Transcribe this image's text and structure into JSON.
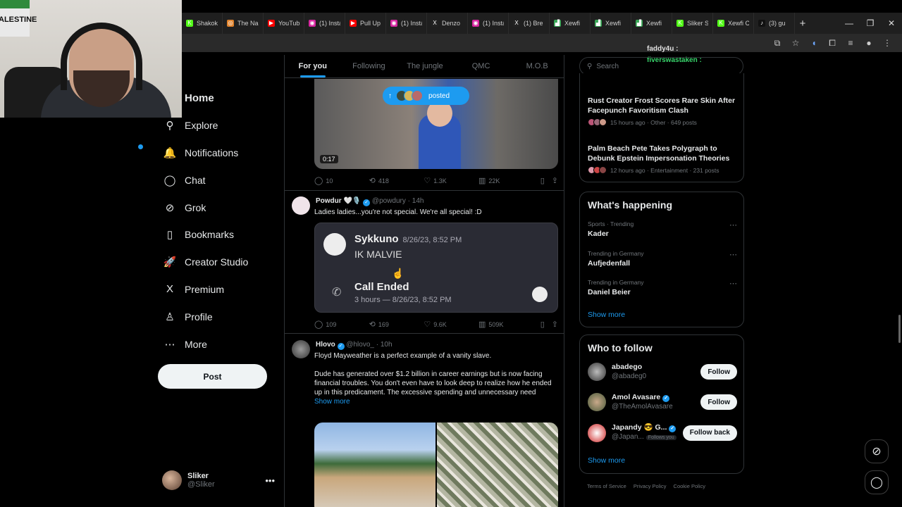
{
  "browser": {
    "tabs": [
      {
        "label": "Shakok",
        "icon": "K",
        "color": "#53fc18"
      },
      {
        "label": "The Na",
        "icon": "◎",
        "color": "#e0822b"
      },
      {
        "label": "YouTub",
        "icon": "▶",
        "color": "#ff0000"
      },
      {
        "label": "(1) Insta",
        "icon": "◉",
        "color": "#d6249f"
      },
      {
        "label": "Pull Up",
        "icon": "▶",
        "color": "#ff0000"
      },
      {
        "label": "(1) Insta",
        "icon": "◉",
        "color": "#d6249f"
      },
      {
        "label": "Denzo",
        "icon": "X",
        "color": "#222222"
      },
      {
        "label": "(1) Insta",
        "icon": "◉",
        "color": "#d6249f"
      },
      {
        "label": "(1) Bre",
        "icon": "X",
        "color": "#222222"
      },
      {
        "label": "Xewfi",
        "icon": "▟",
        "color": "#3aa757"
      },
      {
        "label": "Xewfi",
        "icon": "▟",
        "color": "#3aa757"
      },
      {
        "label": "Xewfi",
        "icon": "▟",
        "color": "#3aa757"
      },
      {
        "label": "Sliker S",
        "icon": "K",
        "color": "#53fc18"
      },
      {
        "label": "Xewfi C",
        "icon": "K",
        "color": "#53fc18"
      },
      {
        "label": "(3) gu",
        "icon": "♪",
        "color": "#111111"
      }
    ]
  },
  "stream_chat": {
    "line1": "faddy4u :",
    "line2": "fiverswastaken :"
  },
  "nav": {
    "items": [
      {
        "name": "home",
        "label": "Home",
        "icon": "⌂"
      },
      {
        "name": "explore",
        "label": "Explore",
        "icon": "⚲"
      },
      {
        "name": "notifications",
        "label": "Notifications",
        "icon": "🔔"
      },
      {
        "name": "chat",
        "label": "Chat",
        "icon": "◯"
      },
      {
        "name": "grok",
        "label": "Grok",
        "icon": "⊘"
      },
      {
        "name": "bookmarks",
        "label": "Bookmarks",
        "icon": "▯"
      },
      {
        "name": "creator-studio",
        "label": "Creator Studio",
        "icon": "🚀"
      },
      {
        "name": "premium",
        "label": "Premium",
        "icon": "X"
      },
      {
        "name": "profile",
        "label": "Profile",
        "icon": "♙"
      },
      {
        "name": "more",
        "label": "More",
        "icon": "⋯"
      }
    ],
    "post_label": "Post",
    "me_name": "Sliker",
    "me_handle": "@Sliker"
  },
  "feed": {
    "tabs": [
      "For you",
      "Following",
      "The jungle",
      "QMC",
      "M.O.B"
    ],
    "posted_label": "posted",
    "tweet1": {
      "duration": "0:17",
      "replies": "10",
      "reposts": "418",
      "likes": "1.3K",
      "views": "22K"
    },
    "tweet2": {
      "name": "Powdur 🤍🎙️",
      "handle": "@powdury · 14h",
      "text": "Ladies ladies...you're not special. We're all special! :D",
      "embed_user": "Sykkuno",
      "embed_date": "8/26/23, 8:52 PM",
      "embed_msg": "IK MALVIE",
      "call_title": "Call Ended",
      "call_detail": "3 hours — 8/26/23, 8:52 PM",
      "replies": "109",
      "reposts": "169",
      "likes": "9.6K",
      "views": "509K"
    },
    "tweet3": {
      "name": "Hlovo",
      "handle": "@hlovo_ · 10h",
      "line1": "Floyd Mayweather is a perfect example of a vanity slave.",
      "line2": "Dude has generated over $1.2 billion in career earnings but is now facing financial troubles. You don't even have to look deep to realize how he ended up in this predicament. The excessive spending and unnecessary need",
      "show_more": "Show more"
    }
  },
  "sidebar": {
    "search_placeholder": "Search",
    "news": [
      {
        "title": "Rust Creator Frost Scores Rare Skin After Facepunch Favoritism Clash",
        "meta": "15 hours ago · Other · 649 posts"
      },
      {
        "title": "Palm Beach Pete Takes Polygraph to Debunk Epstein Impersonation Theories",
        "meta": "12 hours ago · Entertainment · 231 posts"
      }
    ],
    "whats_happening": "What's happening",
    "trends": [
      {
        "context": "Sports · Trending",
        "name": "Kader"
      },
      {
        "context": "Trending in Germany",
        "name": "Aufjedenfall"
      },
      {
        "context": "Trending in Germany",
        "name": "Daniel Beier"
      }
    ],
    "show_more": "Show more",
    "who_to_follow": "Who to follow",
    "follow": [
      {
        "name": "abadego",
        "handle": "@abadeg0",
        "button": "Follow",
        "verified": false
      },
      {
        "name": "Amol Avasare",
        "handle": "@TheAmolAvasare",
        "button": "Follow",
        "verified": true
      },
      {
        "name": "Japandy 😎 G...",
        "handle": "@Japan...",
        "button": "Follow back",
        "verified": true,
        "follows_you": "Follows you"
      }
    ],
    "show_more2": "Show more",
    "footer": [
      "Terms of Service",
      "Privacy Policy",
      "Cookie Policy"
    ]
  }
}
